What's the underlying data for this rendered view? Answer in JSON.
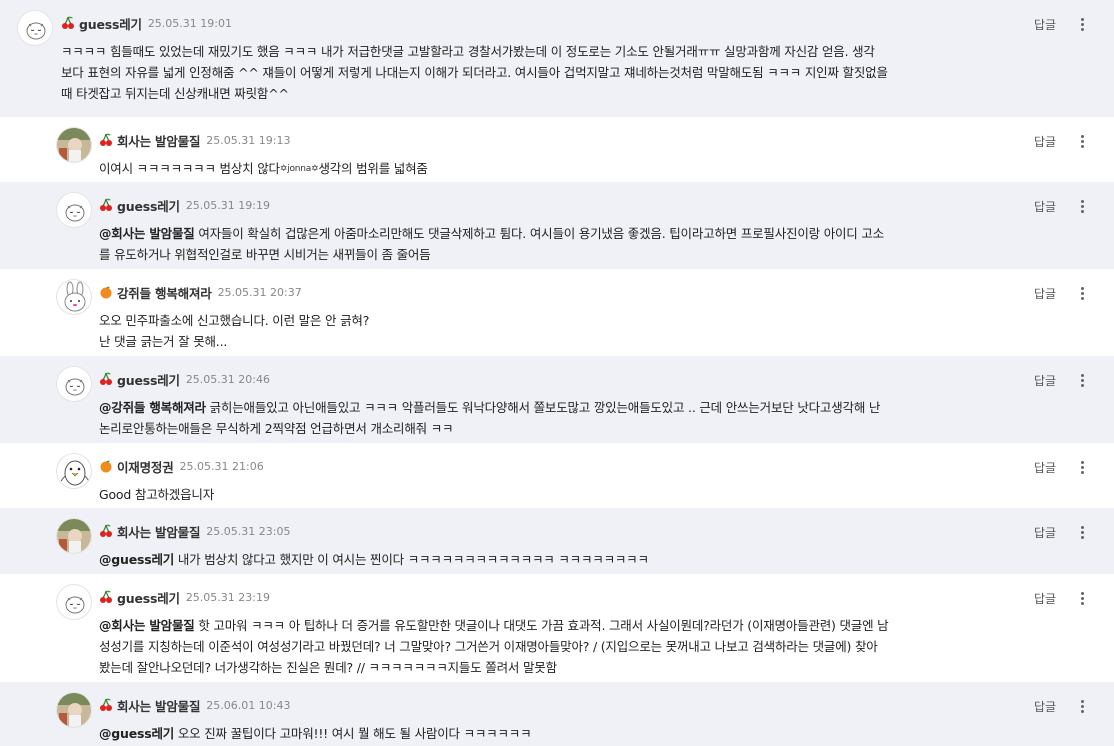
{
  "labels": {
    "reply": "답글"
  },
  "colors": {
    "shaded_bg": "#eff1f6",
    "plain_bg": "#ffffff",
    "cherry": "#d22",
    "orange": "#f28b1e"
  },
  "comments": [
    {
      "nick": "guess레기",
      "time": "25.05.31 19:01",
      "badge": "cherry",
      "avatar": "sleepy-face",
      "mention": "",
      "lines": [
        "ㅋㅋㅋㅋ 힘들때도 있었는데 재밌기도 했음 ㅋㅋㅋ 내가 저급한댓글 고발할라고 경찰서가봤는데 이 정도로는 기소도 안될거래ㅠㅠ 실망과함께 자신감 얻음. 생각",
        "보다 표현의 자유를 넓게 인정해줌 ^^ 쟤들이 어떻게 저렇게 나대는지 이해가 되더라고. 여시들아 겁먹지말고 쟤네하는것처럼 막말해도됨 ㅋㅋㅋ 지인짜 할짓없을",
        "때 타겟잡고 뒤지는데 신상캐내면 짜릿함^^"
      ]
    },
    {
      "nick": "회사는 발암물질",
      "time": "25.05.31 19:13",
      "badge": "cherry",
      "avatar": "photo",
      "mention": "",
      "lines": [
        "이여시 ㅋㅋㅋㅋㅋㅋㅋ 범상치 않다",
        "생각의 범위를 넓혀줌"
      ],
      "emote": "jonna"
    },
    {
      "nick": "guess레기",
      "time": "25.05.31 19:19",
      "badge": "cherry",
      "avatar": "sleepy-face",
      "mention": "@회사는 발암물질",
      "lines": [
        " 여자들이 확실히 겁많은게 아줌마소리만해도 댓글삭제하고 튐다. 여시들이 용기냈음 좋겠음. 팁이라고하면 프로필사진이랑 아이디 고소",
        "를 유도하거나 위협적인걸로 바꾸면 시비거는 새뀌들이 좀 줄어듬"
      ]
    },
    {
      "nick": "강쥐들 행복해져라",
      "time": "25.05.31 20:37",
      "badge": "orange",
      "avatar": "bunny",
      "mention": "",
      "lines": [
        "오오 민주파출소에 신고했습니다. 이런 말은 안 긁혀?",
        "난 댓글 긁는거 잘 못해..."
      ]
    },
    {
      "nick": "guess레기",
      "time": "25.05.31 20:46",
      "badge": "cherry",
      "avatar": "sleepy-face",
      "mention": "@강쥐들 행복해져라",
      "lines": [
        " 긁히는애들있고 아닌애들있고 ㅋㅋㅋ 악플러들도 워낙다양해서 쫄보도많고 깡있는애들도있고 .. 근데 안쓰는거보단 낫다고생각해 난",
        "논리로안통하는애들은 무식하게 2찍약점 언급하면서 개소리해줘 ㅋㅋ"
      ]
    },
    {
      "nick": "이재명정권",
      "time": "25.05.31 21:06",
      "badge": "orange",
      "avatar": "penguin",
      "mention": "",
      "lines": [
        "Good 참고하겠읍니자"
      ]
    },
    {
      "nick": "회사는 발암물질",
      "time": "25.05.31 23:05",
      "badge": "cherry",
      "avatar": "photo",
      "mention": "@guess레기",
      "lines": [
        " 내가 범상치 않다고 했지만 이 여시는 찐이다 ㅋㅋㅋㅋㅋㅋㅋㅋㅋㅋㅋㅋㅋ ㅋㅋㅋㅋㅋㅋㅋㅋ"
      ]
    },
    {
      "nick": "guess레기",
      "time": "25.05.31 23:19",
      "badge": "cherry",
      "avatar": "sleepy-face",
      "mention": "@회사는 발암물질",
      "lines": [
        " 핫 고마워 ㅋㅋㅋ 아 팁하나 더 증거를 유도할만한 댓글이나 대댓도 가끔 효과적. 그래서 사실이뭔데?라던가 (이재명아들관련) 댓글엔 남",
        "성성기를 지칭하는데 이준석이 여성성기라고 바꿨던데? 너 그말맞아? 그거쓴거 이재명아들맞아? / (지입으로는 못꺼내고 나보고 검색하라는 댓글에) 찾아",
        "봤는데 잘안나오던데? 너가생각하는 진실은 뭔데? // ㅋㅋㅋㅋㅋㅋㅋ지들도 쫄려서 말못함"
      ]
    },
    {
      "nick": "회사는 발암물질",
      "time": "25.06.01 10:43",
      "badge": "cherry",
      "avatar": "photo",
      "mention": "@guess레기",
      "lines": [
        " 오오 진짜 꿀팁이다 고마워!!! 여시 뭘 해도 될 사람이다 ㅋㅋㅋㅋㅋㅋ"
      ]
    }
  ]
}
